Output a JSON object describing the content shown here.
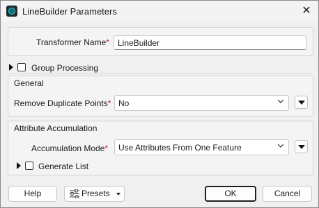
{
  "window": {
    "title": "LineBuilder Parameters",
    "close_glyph": "✕"
  },
  "transformer_name": {
    "label": "Transformer Name",
    "required": "*",
    "value": "LineBuilder"
  },
  "group_processing": {
    "label": "Group Processing"
  },
  "general": {
    "header": "General",
    "remove_duplicate_points": {
      "label": "Remove Duplicate Points",
      "required": "*",
      "value": "No"
    }
  },
  "attribute_accumulation": {
    "header": "Attribute Accumulation",
    "accumulation_mode": {
      "label": "Accumulation Mode",
      "required": "*",
      "value": "Use Attributes From One Feature"
    },
    "generate_list": {
      "label": "Generate List"
    }
  },
  "footer": {
    "help": "Help",
    "presets": "Presets",
    "ok": "OK",
    "cancel": "Cancel"
  },
  "colors": {
    "required": "#cc2020",
    "accent": "#31d0d6"
  }
}
